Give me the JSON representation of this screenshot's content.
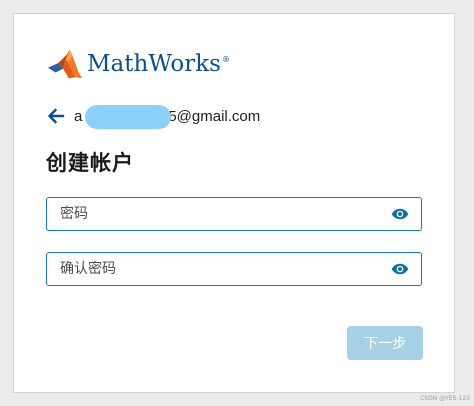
{
  "brand": {
    "name": "MathWorks",
    "registered_mark": "®",
    "logo_icon": "mathworks-membrane-logo",
    "text_color": "#0c4f8a"
  },
  "account": {
    "back_icon": "arrow-left-icon",
    "email_prefix": "a",
    "email_suffix": "5@gmail.com",
    "redaction_color": "#8bd0f6"
  },
  "page": {
    "title": "创建帐户"
  },
  "form": {
    "password": {
      "placeholder": "密码",
      "value": "",
      "toggle_icon": "eye-icon"
    },
    "confirm_password": {
      "placeholder": "确认密码",
      "value": "",
      "toggle_icon": "eye-icon"
    },
    "field_border_color": "#1a78b4",
    "next_label": "下一步",
    "next_button_color": "#a6d0e5",
    "next_enabled": false
  },
  "watermark": "CSDN @YES-123"
}
